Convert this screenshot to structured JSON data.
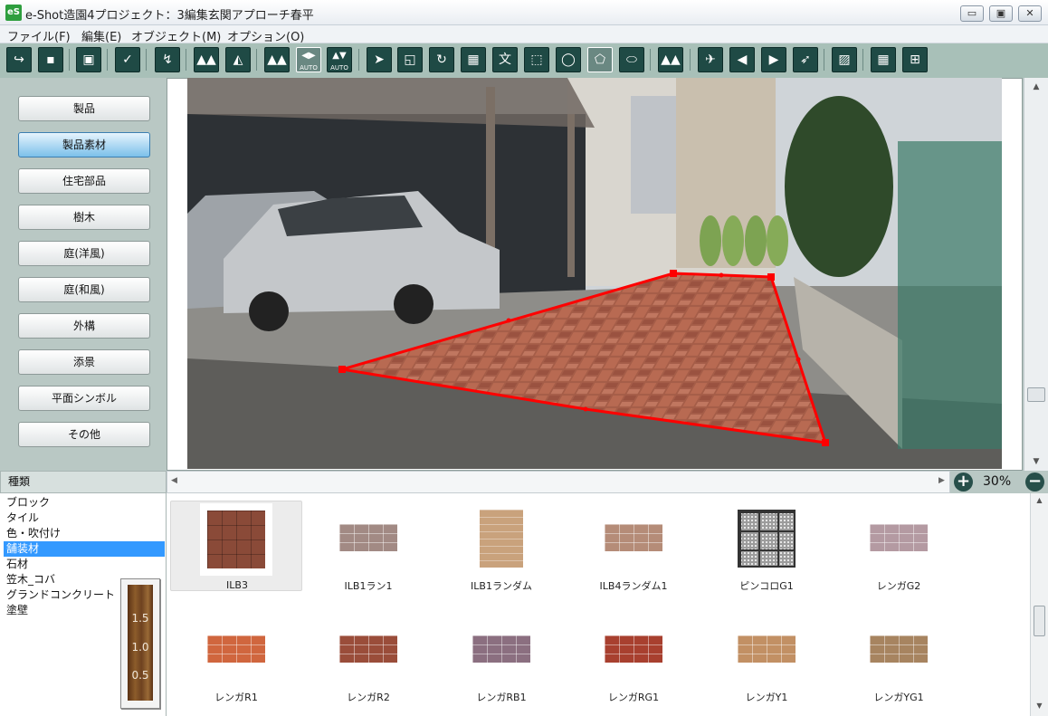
{
  "window": {
    "app_icon": "eS",
    "title": "e-Shot造園4プロジェクト：3編集玄関アプローチ春平",
    "controls": {
      "minimize": "▭",
      "maximize": "▣",
      "close": "✕"
    }
  },
  "menu": [
    "ファイル(F)",
    "編集(E)",
    "オブジェクト(M)",
    "オプション(O)"
  ],
  "toolbar": {
    "auto_label": "AUTO",
    "icons": {
      "open": "↪",
      "save": "▪",
      "photo": "▣",
      "check": "✓",
      "shuffle": "↯",
      "tree_back": "▲▲",
      "tree_photo": "◭",
      "tree_group": "▲▲",
      "flip_h": "◀▶",
      "flip_v": "▲▼",
      "select": "➤",
      "place": "◱",
      "rotate": "↻",
      "picture": "▦",
      "text": "文",
      "rect": "⬚",
      "ellipse": "◯",
      "polygon": "⬠",
      "freeform": "⬭",
      "plant": "▲▲",
      "nav1": "✈",
      "nav_left": "◀",
      "nav_right": "▶",
      "nav4": "➶",
      "hatch": "▨",
      "grid": "▦",
      "grid_tool": "⊞"
    }
  },
  "categories": [
    "製品",
    "製品素材",
    "住宅部品",
    "樹木",
    "庭(洋風)",
    "庭(和風)",
    "外構",
    "添景",
    "平面シンボル",
    "その他"
  ],
  "selected_category": "製品素材",
  "kind_panel": {
    "header": "種類",
    "items": [
      "ブロック",
      "タイル",
      "色・吹付け",
      "舗装材",
      "石材",
      "笠木_コバ",
      "グランドコンクリート",
      "塗壁"
    ],
    "selected": "舗装材"
  },
  "depth_gauge": [
    "1.5",
    "1.0",
    "0.5"
  ],
  "zoom": {
    "plus": "+",
    "minus": "−",
    "level": "30%"
  },
  "materials": [
    {
      "label": "ILB3",
      "color": "#8a4a38",
      "pattern": "basket"
    },
    {
      "label": "ILB1ラン1",
      "color": "#a28a84",
      "pattern": "brick"
    },
    {
      "label": "ILB1ランダム",
      "color": "#c9a27c",
      "pattern": "soft"
    },
    {
      "label": "ILB4ランダム1",
      "color": "#b58c78",
      "pattern": "brick"
    },
    {
      "label": "ピンコロG1",
      "color": "#9c9c9c",
      "pattern": "granite"
    },
    {
      "label": "レンガG2",
      "color": "#b49aa2",
      "pattern": "brick"
    },
    {
      "label": "レンガR1",
      "color": "#d0663e",
      "pattern": "brick"
    },
    {
      "label": "レンガR2",
      "color": "#9a4d3a",
      "pattern": "brick"
    },
    {
      "label": "レンガRB1",
      "color": "#8b6f80",
      "pattern": "brick"
    },
    {
      "label": "レンガRG1",
      "color": "#a8402f",
      "pattern": "brick"
    },
    {
      "label": "レンガY1",
      "color": "#c29064",
      "pattern": "brick"
    },
    {
      "label": "レンガYG1",
      "color": "#a78460",
      "pattern": "brick"
    }
  ],
  "selected_material": "ILB3",
  "colors": {
    "selection_outline": "#ff0000",
    "accent_selected": "#3399ff"
  }
}
